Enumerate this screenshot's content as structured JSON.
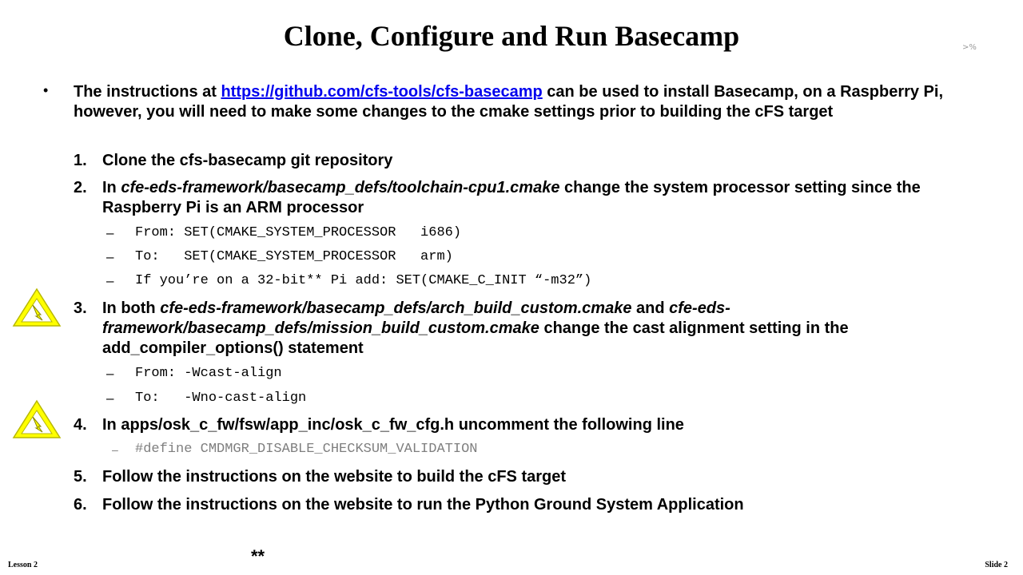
{
  "slide": {
    "title": "Clone, Configure and Run Basecamp",
    "corner_mark": ">%",
    "intro": {
      "before": "The instructions at ",
      "link": "https://github.com/cfs-tools/cfs-basecamp",
      "after": " can be used to install Basecamp, on a Raspberry Pi, however, you will  need to make some changes to the cmake settings prior to building  the cFS target"
    },
    "steps": [
      {
        "num": "1.",
        "text": "Clone the cfs-basecamp git repository"
      },
      {
        "num": "2.",
        "pre": "In ",
        "ital": "cfe-eds-framework/basecamp_defs/toolchain-cpu1.cmake",
        "post": " change the system processor setting since the Raspberry Pi is an ARM processor"
      },
      {
        "num": "3.",
        "pre": "In both ",
        "ital": "cfe-eds-framework/basecamp_defs/arch_build_custom.cmake",
        "mid": " and ",
        "ital2": "cfe-eds-framework/basecamp_defs/mission_build_custom.cmake",
        "post": " change the cast alignment setting in the add_compiler_options() statement"
      },
      {
        "num": "4.",
        "text": "In apps/osk_c_fw/fsw/app_inc/osk_c_fw_cfg.h  uncomment the following  line"
      },
      {
        "num": "5.",
        "text": "Follow  the instructions on the website to build the cFS target"
      },
      {
        "num": "6.",
        "text": "Follow  the instructions on the website to run the Python Ground System Application"
      }
    ],
    "step2_sub": [
      "From: SET(CMAKE_SYSTEM_PROCESSOR   i686)",
      "To:   SET(CMAKE_SYSTEM_PROCESSOR   arm)",
      "If you’re on a 32-bit** Pi add: SET(CMAKE_C_INIT “-m32”)"
    ],
    "step3_sub": [
      "From: -Wcast-align",
      "To:   -Wno-cast-align"
    ],
    "step4_sub": [
      "#define CMDMGR_DISABLE_CHECKSUM_VALIDATION"
    ],
    "bullet": "•",
    "dash": "–",
    "footnote_mark": "**",
    "footer_left": "Lesson 2",
    "footer_right": "Slide 2",
    "icons": {
      "warning": "warning-triangle-icon"
    },
    "colors": {
      "link": "#0000ee",
      "warning_fill": "#ffff00",
      "comment": "#7f7f7f"
    }
  }
}
